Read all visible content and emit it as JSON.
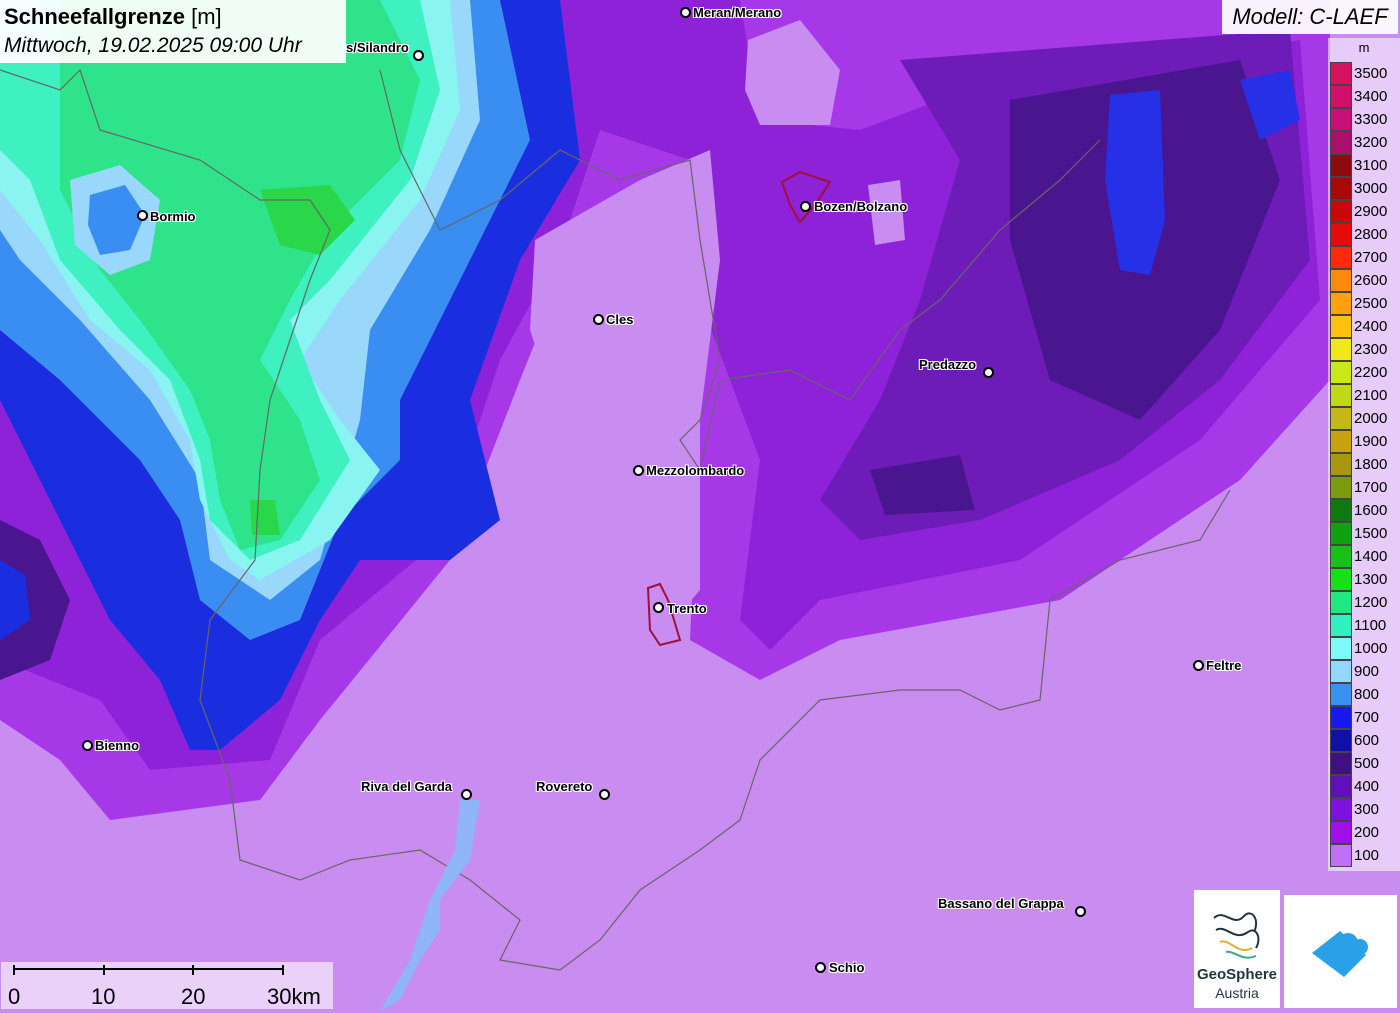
{
  "header": {
    "title_bold": "Schneefallgrenze",
    "title_unit": "[m]",
    "datetime": "Mittwoch, 19.02.2025 09:00 Uhr"
  },
  "model_label": "Modell: C-LAEF",
  "legend": {
    "unit": "m",
    "items": [
      {
        "label": "3500",
        "color": "#d4125e"
      },
      {
        "label": "3400",
        "color": "#d0106b"
      },
      {
        "label": "3300",
        "color": "#c70f75"
      },
      {
        "label": "3200",
        "color": "#a8106b"
      },
      {
        "label": "3100",
        "color": "#8c0a10"
      },
      {
        "label": "3000",
        "color": "#a80808"
      },
      {
        "label": "2900",
        "color": "#c80808"
      },
      {
        "label": "2800",
        "color": "#e80a0a"
      },
      {
        "label": "2700",
        "color": "#ff2a0a"
      },
      {
        "label": "2600",
        "color": "#ff8a10"
      },
      {
        "label": "2500",
        "color": "#ffa010"
      },
      {
        "label": "2400",
        "color": "#ffc010"
      },
      {
        "label": "2300",
        "color": "#f0e818"
      },
      {
        "label": "2200",
        "color": "#c8e818"
      },
      {
        "label": "2100",
        "color": "#c0d818"
      },
      {
        "label": "2000",
        "color": "#c4b818"
      },
      {
        "label": "1900",
        "color": "#c8a010"
      },
      {
        "label": "1800",
        "color": "#a89810"
      },
      {
        "label": "1700",
        "color": "#7c9a10"
      },
      {
        "label": "1600",
        "color": "#107810"
      },
      {
        "label": "1500",
        "color": "#10a010"
      },
      {
        "label": "1400",
        "color": "#18c018"
      },
      {
        "label": "1300",
        "color": "#18e018"
      },
      {
        "label": "1200",
        "color": "#20e880"
      },
      {
        "label": "1100",
        "color": "#30f0c0"
      },
      {
        "label": "1000",
        "color": "#80f8f8"
      },
      {
        "label": "900",
        "color": "#90d8ff"
      },
      {
        "label": "800",
        "color": "#3890f0"
      },
      {
        "label": "700",
        "color": "#1818f0"
      },
      {
        "label": "600",
        "color": "#1010a8"
      },
      {
        "label": "500",
        "color": "#401080"
      },
      {
        "label": "400",
        "color": "#6010b8"
      },
      {
        "label": "300",
        "color": "#8010e0"
      },
      {
        "label": "200",
        "color": "#a010e8"
      },
      {
        "label": "100",
        "color": "#c070f8"
      }
    ]
  },
  "cities": [
    {
      "name": "Meran/Merano",
      "icon": "city-dot-icon"
    },
    {
      "name": "s/Silandro",
      "icon": "city-dot-icon"
    },
    {
      "name": "Bormio",
      "icon": "city-dot-icon"
    },
    {
      "name": "Bozen/Bolzano",
      "icon": "city-dot-icon"
    },
    {
      "name": "Cles",
      "icon": "city-dot-icon"
    },
    {
      "name": "Predazzo",
      "icon": "city-dot-icon"
    },
    {
      "name": "Mezzolombardo",
      "icon": "city-dot-icon"
    },
    {
      "name": "Trento",
      "icon": "city-dot-icon"
    },
    {
      "name": "Feltre",
      "icon": "city-dot-icon"
    },
    {
      "name": "Bienno",
      "icon": "city-dot-icon"
    },
    {
      "name": "Riva del Garda",
      "icon": "city-dot-icon"
    },
    {
      "name": "Rovereto",
      "icon": "city-dot-icon"
    },
    {
      "name": "Bassano del Grappa",
      "icon": "city-dot-icon"
    },
    {
      "name": "Schio",
      "icon": "city-dot-icon"
    }
  ],
  "scalebar": {
    "labels": [
      "0",
      "10",
      "20",
      "30km"
    ]
  },
  "logos": {
    "geosphere_line1": "GeoSphere",
    "geosphere_line2": "Austria",
    "app_icon": "cloud-app-icon"
  }
}
